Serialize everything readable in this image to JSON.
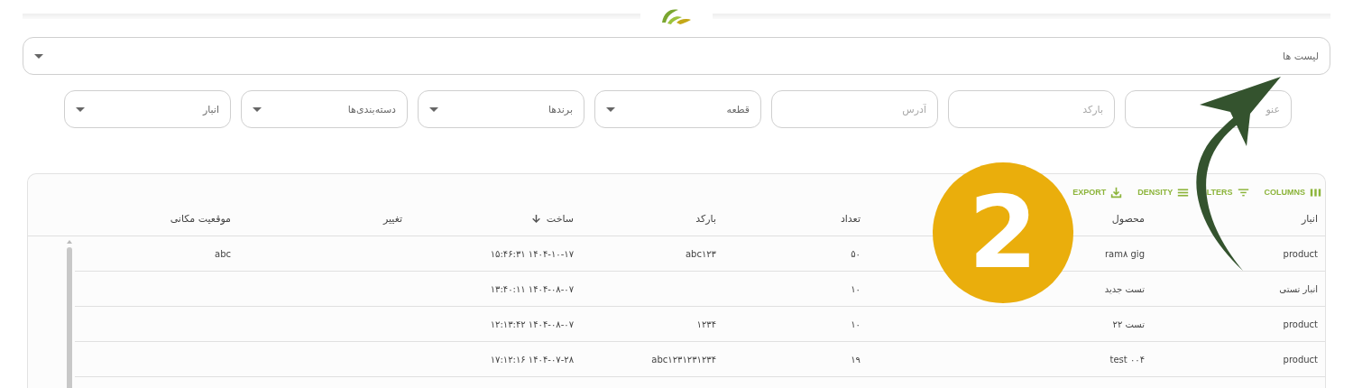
{
  "list_select": {
    "label": "لیست ها"
  },
  "filters": [
    {
      "kind": "text",
      "placeholder": "عنو"
    },
    {
      "kind": "text",
      "placeholder": "بارکد"
    },
    {
      "kind": "text",
      "placeholder": "آدرس"
    },
    {
      "kind": "select",
      "label": "قطعه"
    },
    {
      "kind": "select",
      "label": "برندها"
    },
    {
      "kind": "select",
      "label": "دسته‌بندی‌ها"
    },
    {
      "kind": "select",
      "label": "انبار"
    }
  ],
  "toolbar": [
    {
      "kind": "columns",
      "label": "COLUMNS"
    },
    {
      "kind": "filters",
      "label": "ILTERS"
    },
    {
      "kind": "density",
      "label": "DENSITY"
    },
    {
      "kind": "export",
      "label": "EXPORT"
    }
  ],
  "table": {
    "columns": [
      {
        "label": "انبار",
        "sorted": false
      },
      {
        "label": "محصول",
        "sorted": false
      },
      {
        "label": "تعداد",
        "sorted": false
      },
      {
        "label": "بارکد",
        "sorted": false
      },
      {
        "label": "ساخت",
        "sorted": true
      },
      {
        "label": "تغییر",
        "sorted": false
      },
      {
        "label": "موقعیت مکانی",
        "sorted": false
      }
    ],
    "rows": [
      [
        "product",
        "ram۸ gig",
        "۵۰",
        "abc۱۲۳",
        "۱۴۰۴-۱۰-۱۷ ۱۵:۴۶:۳۱",
        null,
        "abc"
      ],
      [
        "انبار تستی",
        "تست جدید",
        "۱۰",
        null,
        "۱۴۰۴-۰۸-۰۷ ۱۳:۴۰:۱۱",
        null,
        null
      ],
      [
        "product",
        "تست ۲۲",
        "۱۰",
        "۱۲۳۴",
        "۱۴۰۴-۰۸-۰۷ ۱۲:۱۳:۴۲",
        null,
        null
      ],
      [
        "product",
        "test ۰۰۴",
        "۱۹",
        "abc۱۲۳۱۲۳۱۲۳۴",
        "۱۴۰۴-۰۷-۲۸ ۱۷:۱۲:۱۶",
        null,
        null
      ]
    ]
  },
  "badge": {
    "label": "2"
  }
}
